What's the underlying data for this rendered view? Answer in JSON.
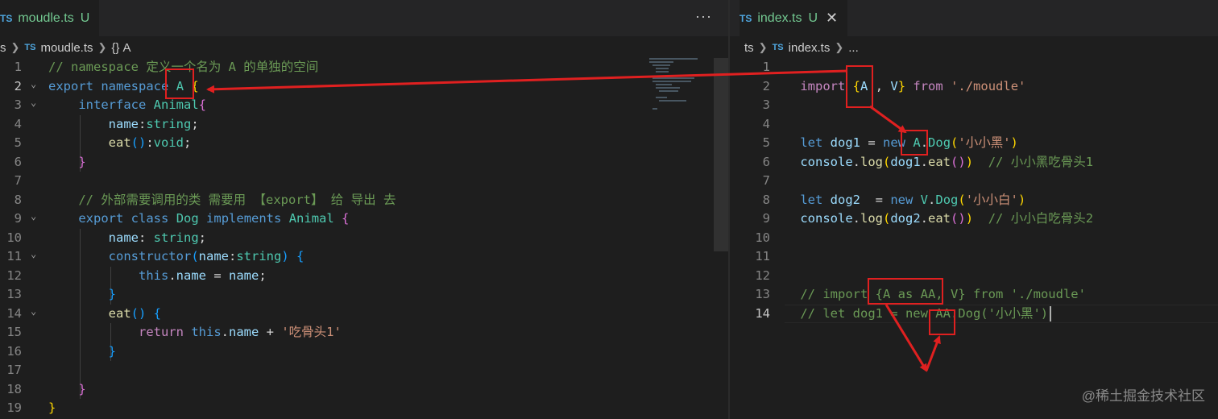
{
  "left_editor": {
    "tab": {
      "badge": "TS",
      "filename": "moudle.ts",
      "status": "U"
    },
    "more_actions": "···",
    "breadcrumb": {
      "folder": "s",
      "badge": "TS",
      "file": "moudle.ts",
      "symbol_icon": "{}",
      "symbol": "A"
    },
    "lines": [
      {
        "n": "1",
        "fold": "",
        "code": [
          [
            "comment",
            "// namespace 定义一个名为 A 的单独的空间"
          ]
        ]
      },
      {
        "n": "2",
        "fold": "⌄",
        "active": true,
        "code": [
          [
            "kw",
            "export"
          ],
          [
            "plain",
            " "
          ],
          [
            "kw",
            "namespace"
          ],
          [
            "plain",
            " "
          ],
          [
            "type",
            "A"
          ],
          [
            "plain",
            " "
          ],
          [
            "br1",
            "{"
          ]
        ]
      },
      {
        "n": "3",
        "fold": "⌄",
        "code": [
          [
            "plain",
            "    "
          ],
          [
            "kw",
            "interface"
          ],
          [
            "plain",
            " "
          ],
          [
            "type",
            "Animal"
          ],
          [
            "br2",
            "{"
          ]
        ]
      },
      {
        "n": "4",
        "fold": "",
        "code": [
          [
            "plain",
            "        "
          ],
          [
            "var",
            "name"
          ],
          [
            "plain",
            ":"
          ],
          [
            "type",
            "string"
          ],
          [
            "plain",
            ";"
          ]
        ]
      },
      {
        "n": "5",
        "fold": "",
        "code": [
          [
            "plain",
            "        "
          ],
          [
            "func",
            "eat"
          ],
          [
            "br3",
            "()"
          ],
          [
            "plain",
            ":"
          ],
          [
            "type",
            "void"
          ],
          [
            "plain",
            ";"
          ]
        ]
      },
      {
        "n": "6",
        "fold": "",
        "code": [
          [
            "plain",
            "    "
          ],
          [
            "br2",
            "}"
          ]
        ]
      },
      {
        "n": "7",
        "fold": "",
        "code": []
      },
      {
        "n": "8",
        "fold": "",
        "code": [
          [
            "plain",
            "    "
          ],
          [
            "comment",
            "// 外部需要调用的类 需要用 【export】 给 导出 去"
          ]
        ]
      },
      {
        "n": "9",
        "fold": "⌄",
        "code": [
          [
            "plain",
            "    "
          ],
          [
            "kw",
            "export"
          ],
          [
            "plain",
            " "
          ],
          [
            "kw",
            "class"
          ],
          [
            "plain",
            " "
          ],
          [
            "type",
            "Dog"
          ],
          [
            "plain",
            " "
          ],
          [
            "kw",
            "implements"
          ],
          [
            "plain",
            " "
          ],
          [
            "type",
            "Animal"
          ],
          [
            "plain",
            " "
          ],
          [
            "br2",
            "{"
          ]
        ]
      },
      {
        "n": "10",
        "fold": "",
        "code": [
          [
            "plain",
            "        "
          ],
          [
            "var",
            "name"
          ],
          [
            "plain",
            ": "
          ],
          [
            "type",
            "string"
          ],
          [
            "plain",
            ";"
          ]
        ]
      },
      {
        "n": "11",
        "fold": "⌄",
        "code": [
          [
            "plain",
            "        "
          ],
          [
            "kw",
            "constructor"
          ],
          [
            "br3",
            "("
          ],
          [
            "var",
            "name"
          ],
          [
            "plain",
            ":"
          ],
          [
            "type",
            "string"
          ],
          [
            "br3",
            ")"
          ],
          [
            "plain",
            " "
          ],
          [
            "br3",
            "{"
          ]
        ]
      },
      {
        "n": "12",
        "fold": "",
        "code": [
          [
            "plain",
            "            "
          ],
          [
            "kw",
            "this"
          ],
          [
            "plain",
            "."
          ],
          [
            "var",
            "name"
          ],
          [
            "plain",
            " = "
          ],
          [
            "var",
            "name"
          ],
          [
            "plain",
            ";"
          ]
        ]
      },
      {
        "n": "13",
        "fold": "",
        "code": [
          [
            "plain",
            "        "
          ],
          [
            "br3",
            "}"
          ]
        ]
      },
      {
        "n": "14",
        "fold": "⌄",
        "code": [
          [
            "plain",
            "        "
          ],
          [
            "func",
            "eat"
          ],
          [
            "br3",
            "()"
          ],
          [
            "plain",
            " "
          ],
          [
            "br3",
            "{"
          ]
        ]
      },
      {
        "n": "15",
        "fold": "",
        "code": [
          [
            "plain",
            "            "
          ],
          [
            "ctrl",
            "return"
          ],
          [
            "plain",
            " "
          ],
          [
            "kw",
            "this"
          ],
          [
            "plain",
            "."
          ],
          [
            "var",
            "name"
          ],
          [
            "plain",
            " + "
          ],
          [
            "str",
            "'吃骨头1'"
          ]
        ]
      },
      {
        "n": "16",
        "fold": "",
        "code": [
          [
            "plain",
            "        "
          ],
          [
            "br3",
            "}"
          ]
        ]
      },
      {
        "n": "17",
        "fold": "",
        "code": []
      },
      {
        "n": "18",
        "fold": "",
        "code": [
          [
            "plain",
            "    "
          ],
          [
            "br2",
            "}"
          ]
        ]
      },
      {
        "n": "19",
        "fold": "",
        "code": [
          [
            "br1",
            "}"
          ]
        ]
      }
    ]
  },
  "right_editor": {
    "tab": {
      "badge": "TS",
      "filename": "index.ts",
      "status": "U",
      "close": "✕"
    },
    "breadcrumb": {
      "folder": "ts",
      "badge": "TS",
      "file": "index.ts",
      "symbol": "..."
    },
    "lines": [
      {
        "n": "1",
        "code": []
      },
      {
        "n": "2",
        "code": [
          [
            "plain",
            "    "
          ],
          [
            "ctrl",
            "import"
          ],
          [
            "plain",
            " "
          ],
          [
            "br1",
            "{"
          ],
          [
            "var",
            "A"
          ],
          [
            "plain",
            " , "
          ],
          [
            "var",
            "V"
          ],
          [
            "br1",
            "}"
          ],
          [
            "plain",
            " "
          ],
          [
            "ctrl",
            "from"
          ],
          [
            "plain",
            " "
          ],
          [
            "str",
            "'./moudle'"
          ]
        ]
      },
      {
        "n": "3",
        "code": []
      },
      {
        "n": "4",
        "code": []
      },
      {
        "n": "5",
        "code": [
          [
            "plain",
            "    "
          ],
          [
            "kw",
            "let"
          ],
          [
            "plain",
            " "
          ],
          [
            "var",
            "dog1"
          ],
          [
            "plain",
            " = "
          ],
          [
            "kw",
            "new"
          ],
          [
            "plain",
            " "
          ],
          [
            "type",
            "A"
          ],
          [
            "plain",
            "."
          ],
          [
            "type",
            "Dog"
          ],
          [
            "br1",
            "("
          ],
          [
            "str",
            "'小小黑'"
          ],
          [
            "br1",
            ")"
          ]
        ]
      },
      {
        "n": "6",
        "code": [
          [
            "plain",
            "    "
          ],
          [
            "var",
            "console"
          ],
          [
            "plain",
            "."
          ],
          [
            "func",
            "log"
          ],
          [
            "br1",
            "("
          ],
          [
            "var",
            "dog1"
          ],
          [
            "plain",
            "."
          ],
          [
            "func",
            "eat"
          ],
          [
            "br2",
            "()"
          ],
          [
            "br1",
            ")"
          ],
          [
            "plain",
            "  "
          ],
          [
            "comment",
            "// 小小黑吃骨头1"
          ]
        ]
      },
      {
        "n": "7",
        "code": []
      },
      {
        "n": "8",
        "code": [
          [
            "plain",
            "    "
          ],
          [
            "kw",
            "let"
          ],
          [
            "plain",
            " "
          ],
          [
            "var",
            "dog2"
          ],
          [
            "plain",
            "  = "
          ],
          [
            "kw",
            "new"
          ],
          [
            "plain",
            " "
          ],
          [
            "type",
            "V"
          ],
          [
            "plain",
            "."
          ],
          [
            "type",
            "Dog"
          ],
          [
            "br1",
            "("
          ],
          [
            "str",
            "'小小白'"
          ],
          [
            "br1",
            ")"
          ]
        ]
      },
      {
        "n": "9",
        "code": [
          [
            "plain",
            "    "
          ],
          [
            "var",
            "console"
          ],
          [
            "plain",
            "."
          ],
          [
            "func",
            "log"
          ],
          [
            "br1",
            "("
          ],
          [
            "var",
            "dog2"
          ],
          [
            "plain",
            "."
          ],
          [
            "func",
            "eat"
          ],
          [
            "br2",
            "()"
          ],
          [
            "br1",
            ")"
          ],
          [
            "plain",
            "  "
          ],
          [
            "comment",
            "// 小小白吃骨头2"
          ]
        ]
      },
      {
        "n": "10",
        "code": []
      },
      {
        "n": "11",
        "code": []
      },
      {
        "n": "12",
        "code": []
      },
      {
        "n": "13",
        "code": [
          [
            "plain",
            "    "
          ],
          [
            "comment",
            "// import {A as AA, V} from './moudle'"
          ]
        ]
      },
      {
        "n": "14",
        "active": true,
        "code": [
          [
            "plain",
            "    "
          ],
          [
            "comment",
            "// let dog1 = new AA.Dog('小小黑')"
          ]
        ]
      }
    ]
  },
  "watermark": "@稀土掘金技术社区",
  "colors": {
    "annotation_red": "#e02020",
    "background": "#1e1e1e"
  }
}
